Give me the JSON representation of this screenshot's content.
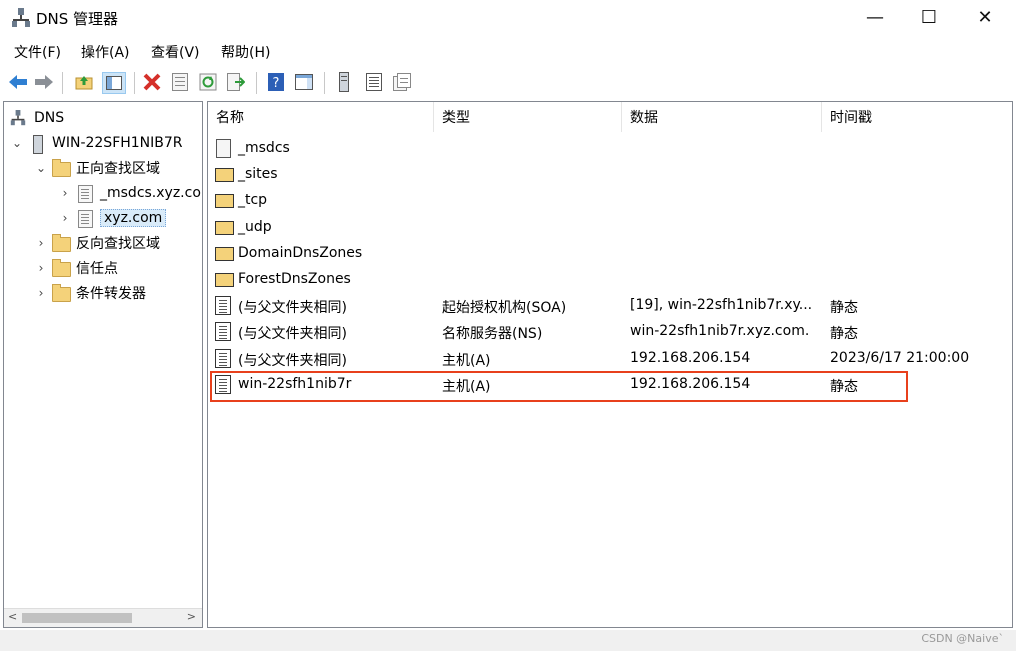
{
  "window": {
    "title": "DNS 管理器",
    "minimize": "—",
    "maximize": "☐",
    "close": "✕"
  },
  "menu": [
    "文件(F)",
    "操作(A)",
    "查看(V)",
    "帮助(H)"
  ],
  "toolbar": {
    "icons": [
      "back-icon",
      "forward-icon",
      "up-folder-icon",
      "show-hide-tree-icon",
      "delete-icon",
      "properties-icon",
      "refresh-icon",
      "export-list-icon",
      "help-icon",
      "show-hide-action-pane-icon",
      "server-icon",
      "zone-icon",
      "new-zone-icon"
    ]
  },
  "tree": [
    {
      "label": "DNS",
      "level": 0,
      "expander": "",
      "icon": "dns-icon"
    },
    {
      "label": "WIN-22SFH1NIB7R",
      "level": 0,
      "expander": "v",
      "icon": "server-icon"
    },
    {
      "label": "正向查找区域",
      "level": 1,
      "expander": "v",
      "icon": "folder-icon"
    },
    {
      "label": "_msdcs.xyz.com",
      "level": 2,
      "expander": ">",
      "icon": "zone-icon"
    },
    {
      "label": "xyz.com",
      "level": 2,
      "expander": ">",
      "icon": "zone-icon",
      "selected": true
    },
    {
      "label": "反向查找区域",
      "level": 1,
      "expander": ">",
      "icon": "folder-icon"
    },
    {
      "label": "信任点",
      "level": 1,
      "expander": ">",
      "icon": "folder-icon"
    },
    {
      "label": "条件转发器",
      "level": 1,
      "expander": ">",
      "icon": "folder-icon"
    }
  ],
  "columns": [
    "名称",
    "类型",
    "数据",
    "时间戳"
  ],
  "records": [
    {
      "name": "_msdcs",
      "type": "",
      "data": "",
      "timestamp": "",
      "icon": "delegation-icon"
    },
    {
      "name": "_sites",
      "type": "",
      "data": "",
      "timestamp": "",
      "icon": "folder-icon"
    },
    {
      "name": "_tcp",
      "type": "",
      "data": "",
      "timestamp": "",
      "icon": "folder-icon"
    },
    {
      "name": "_udp",
      "type": "",
      "data": "",
      "timestamp": "",
      "icon": "folder-icon"
    },
    {
      "name": "DomainDnsZones",
      "type": "",
      "data": "",
      "timestamp": "",
      "icon": "folder-icon"
    },
    {
      "name": "ForestDnsZones",
      "type": "",
      "data": "",
      "timestamp": "",
      "icon": "folder-icon"
    },
    {
      "name": "(与父文件夹相同)",
      "type": "起始授权机构(SOA)",
      "data": "[19], win-22sfh1nib7r.xy...",
      "timestamp": "静态",
      "icon": "record-icon"
    },
    {
      "name": "(与父文件夹相同)",
      "type": "名称服务器(NS)",
      "data": "win-22sfh1nib7r.xyz.com.",
      "timestamp": "静态",
      "icon": "record-icon"
    },
    {
      "name": "(与父文件夹相同)",
      "type": "主机(A)",
      "data": "192.168.206.154",
      "timestamp": "2023/6/17 21:00:00",
      "icon": "record-icon"
    },
    {
      "name": "win-22sfh1nib7r",
      "type": "主机(A)",
      "data": "192.168.206.154",
      "timestamp": "静态",
      "icon": "record-icon",
      "highlighted": true
    }
  ],
  "statusbar": {
    "watermark": "CSDN @Naive`"
  },
  "colors": {
    "highlight": "#e8401c",
    "selection": "#d9ebf9"
  }
}
